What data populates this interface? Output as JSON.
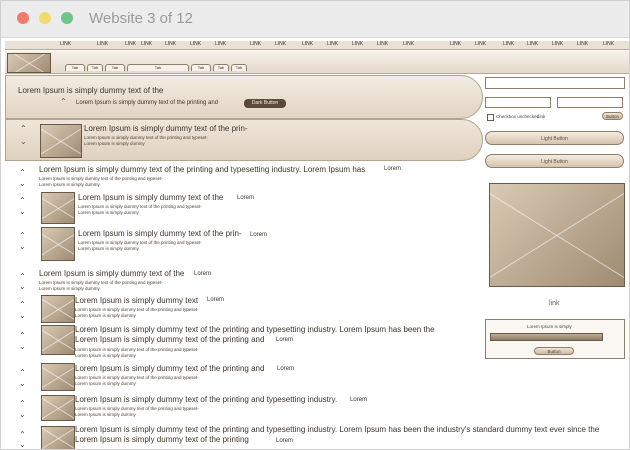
{
  "window": {
    "title": "Website 3 of 12"
  },
  "nav": {
    "links": [
      "LINK",
      "LINK",
      "LINK",
      "LINK",
      "LINK",
      "LINK",
      "LINK",
      "LINK",
      "LINK",
      "LINK",
      "LINK",
      "LINK",
      "LINK",
      "LINK",
      "LINK",
      "LINK",
      "LINK",
      "LINK",
      "LINK",
      "LINK",
      "LINK"
    ]
  },
  "tabs": [
    "Tab",
    "Tab",
    "Tab",
    "Tab",
    "Tab",
    "Tab",
    "Tab"
  ],
  "hero": {
    "title": "Lorem Ipsum is simply dummy text of the",
    "subtitle": "Lorem Ipsum is simply dummy text of the printing and",
    "button": "Dark Button"
  },
  "band2": {
    "title": "Lorem Ipsum is simply dummy text of the prin-",
    "lines": [
      "Lorem Ipsum is simply dummy text of the printing and typeset-",
      "Lorem Ipsum is simply dummy"
    ]
  },
  "rows": [
    {
      "title": "Lorem Ipsum is simply dummy text of the printing and typesetting industry. Lorem Ipsum has",
      "lorem": "Lorem",
      "lines": [
        "Lorem Ipsum is simply dummy text of the printing and typeset-",
        "Lorem Ipsum is simply dummy"
      ]
    },
    {
      "title": "Lorem Ipsum is simply dummy text of the",
      "lorem": "Lorem",
      "lines": [
        "Lorem Ipsum is simply dummy text of the printing and typeset-",
        "Lorem Ipsum is simply dummy"
      ]
    },
    {
      "title": "Lorem Ipsum is simply dummy text of the prin-",
      "lorem": "Lorem",
      "lines": [
        "Lorem Ipsum is simply dummy text of the printing and typeset-",
        "Lorem Ipsum is simply dummy"
      ]
    },
    {
      "title": "Lorem Ipsum is simply dummy text of the",
      "lorem": "Lorem",
      "lines": [
        "Lorem Ipsum is simply dummy text of the printing and typeset-",
        "Lorem Ipsum is simply dummy"
      ]
    },
    {
      "title": "Lorem Ipsum is simply dummy text",
      "lorem": "Lorem",
      "lines": [
        "Lorem Ipsum is simply dummy text of the printing and typeset-",
        "Lorem Ipsum is simply dummy"
      ]
    },
    {
      "title": "Lorem Ipsum is simply dummy text of the printing and typesetting industry. Lorem Ipsum has been the",
      "title2": "Lorem Ipsum is simply dummy text of the printing and",
      "lorem": "Lorem",
      "lines": [
        "Lorem Ipsum is simply dummy text of the printing and typeset-",
        "Lorem Ipsum is simply dummy"
      ]
    },
    {
      "title": "Lorem Ipsum is simply dummy text of the printing and",
      "lorem": "Lorem",
      "lines": [
        "Lorem Ipsum is simply dummy text of the printing and typeset-",
        "Lorem Ipsum is simply dummy"
      ]
    },
    {
      "title": "Lorem Ipsum is simply dummy text of the printing and typesetting industry.",
      "lorem": "Lorem",
      "lines": [
        "Lorem Ipsum is simply dummy text of the printing and typeset-",
        "Lorem Ipsum is simply dummy"
      ]
    },
    {
      "title": "Lorem Ipsum is simply dummy text of the printing and typesetting industry. Lorem Ipsum has been the industry's standard dummy text ever since the",
      "title2": "Lorem Ipsum is simply dummy text of the printing",
      "lorem": "Lorem",
      "lines": []
    }
  ],
  "sidebar": {
    "checkbox_label": "Checkbox unchecked",
    "link_small": "Link",
    "button_small": "Button",
    "light_button_1": "Light Button",
    "light_button_2": "Light Button",
    "link": "link",
    "panel_text": "Lorem Ipsum is simply",
    "panel_button": "Button"
  }
}
